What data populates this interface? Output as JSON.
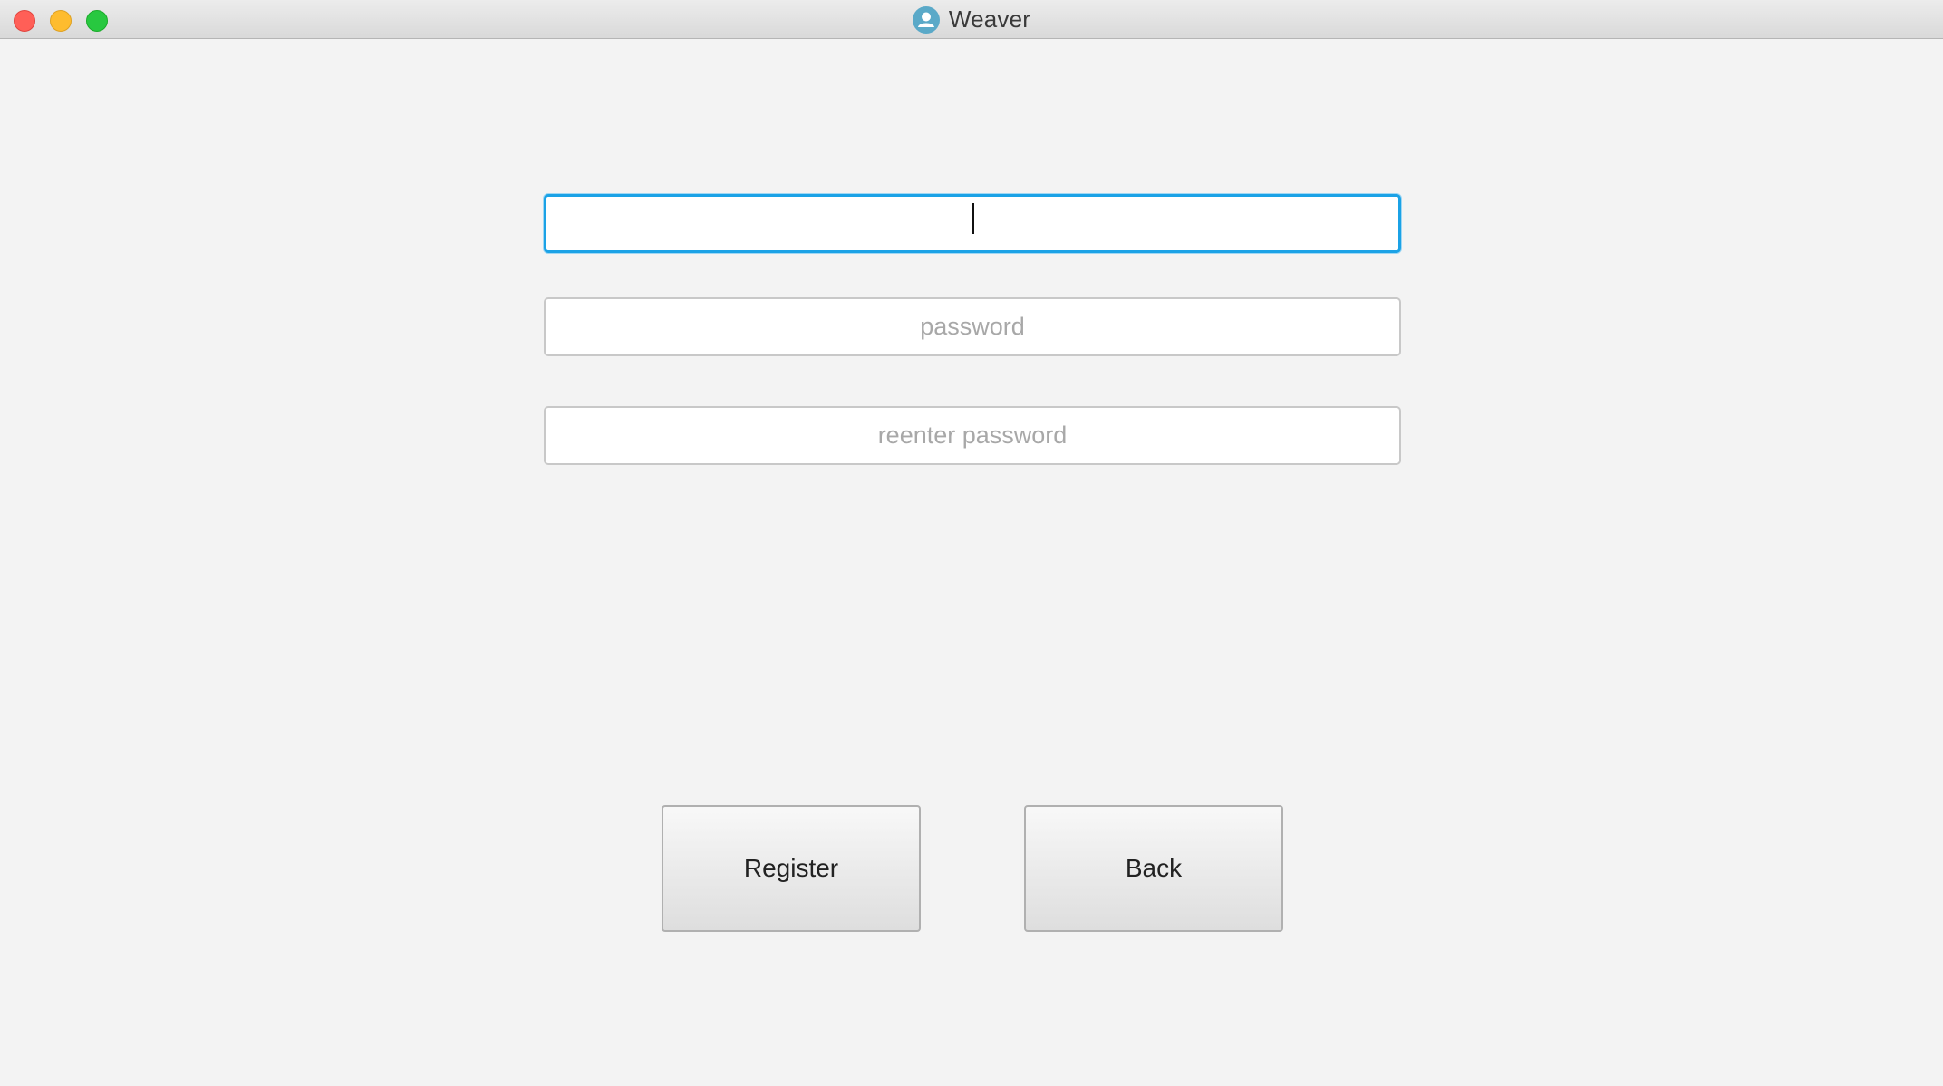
{
  "window": {
    "title": "Weaver",
    "app_icon": "user-avatar-icon",
    "controls": [
      "close",
      "minimize",
      "zoom"
    ]
  },
  "form": {
    "username": {
      "value": "",
      "placeholder": ""
    },
    "password": {
      "value": "",
      "placeholder": "password"
    },
    "reenter_password": {
      "value": "",
      "placeholder": "reenter password"
    }
  },
  "buttons": {
    "register_label": "Register",
    "back_label": "Back"
  },
  "colors": {
    "background": "#f3f3f3",
    "focus_ring": "#1ba2e6",
    "close": "#ff5f57",
    "minimize": "#febc2e",
    "zoom": "#28c840",
    "app_icon": "#5aa9c8"
  }
}
